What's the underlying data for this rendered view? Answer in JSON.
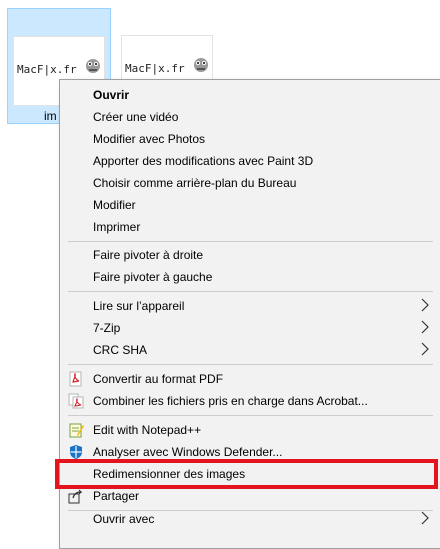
{
  "files": [
    {
      "thumb_text": "MacF|x.fr",
      "label": "im",
      "selected": true
    },
    {
      "thumb_text": "MacF|x.fr",
      "label": "",
      "selected": false
    }
  ],
  "menu": {
    "items": [
      {
        "label": "Ouvrir",
        "bold": true
      },
      {
        "label": "Créer une vidéo"
      },
      {
        "label": "Modifier avec Photos"
      },
      {
        "label": "Apporter des modifications avec Paint 3D"
      },
      {
        "label": "Choisir comme arrière-plan du Bureau"
      },
      {
        "label": "Modifier"
      },
      {
        "label": "Imprimer"
      },
      {
        "label": "Faire pivoter à droite"
      },
      {
        "label": "Faire pivoter à gauche"
      },
      {
        "label": "Lire sur l’appareil",
        "submenu": true
      },
      {
        "label": "7-Zip",
        "submenu": true
      },
      {
        "label": "CRC SHA",
        "submenu": true
      },
      {
        "label": "Convertir au format PDF",
        "icon": "pdf-icon"
      },
      {
        "label": "Combiner les fichiers pris en charge dans Acrobat...",
        "icon": "acrobat-combine-icon"
      },
      {
        "label": "Edit with Notepad++",
        "icon": "notepad-plus-plus-icon"
      },
      {
        "label": "Analyser avec Windows Defender...",
        "icon": "windows-defender-icon"
      },
      {
        "label": "Redimensionner des images"
      },
      {
        "label": "Partager",
        "icon": "share-icon"
      },
      {
        "label": "Ouvrir avec",
        "submenu": true
      }
    ]
  },
  "highlight_color": "#e4141e"
}
